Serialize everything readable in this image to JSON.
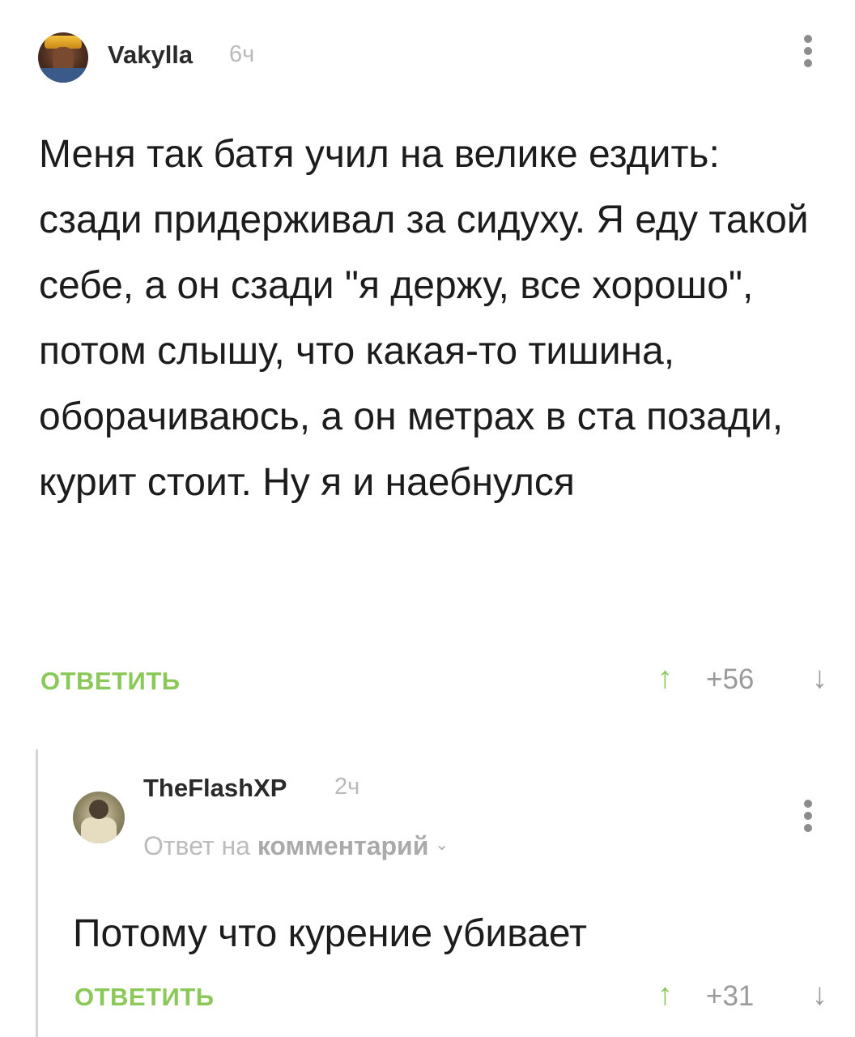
{
  "comments": [
    {
      "author": "Vakylla",
      "time": "6ч",
      "text": "Меня так батя учил на велике ездить: сзади придерживал за сидуху. Я еду такой себе, а он сзади \"я держу, все хорошо\", потом слышу, что какая-то тишина, оборачиваюсь, а он метрах в ста позади, курит стоит. Ну я и наебнулся",
      "reply_label": "ОТВЕТИТЬ",
      "score": "+56",
      "up_icon": "arrow-up-icon",
      "down_icon": "arrow-down-icon",
      "more_icon": "more-vertical-icon"
    },
    {
      "author": "TheFlashXP",
      "time": "2ч",
      "reply_to_prefix": "Ответ на",
      "reply_to_link": "комментарий",
      "text": "Потому что курение убивает",
      "reply_label": "ОТВЕТИТЬ",
      "score": "+31",
      "up_icon": "arrow-up-icon",
      "down_icon": "arrow-down-icon",
      "more_icon": "more-vertical-icon"
    }
  ],
  "colors": {
    "accent_green": "#8ac858",
    "muted_gray": "#9a9a9a",
    "thread_line": "#d5d5d5"
  }
}
